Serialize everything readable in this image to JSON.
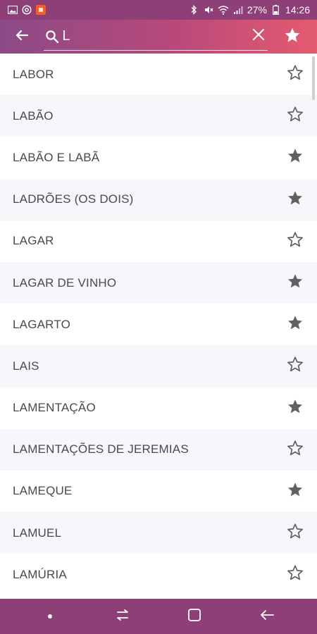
{
  "status_bar": {
    "battery": "27%",
    "time": "14:26"
  },
  "app_bar": {
    "search_value": "L",
    "colors": {
      "gradient_start": "#8b4a86",
      "gradient_end": "#e45b6f"
    }
  },
  "items": [
    {
      "label": "LABOR",
      "favorite": false
    },
    {
      "label": "LABÃO",
      "favorite": false
    },
    {
      "label": "LABÃO E LABÃ",
      "favorite": true
    },
    {
      "label": "LADRÕES (OS DOIS)",
      "favorite": true
    },
    {
      "label": "LAGAR",
      "favorite": false
    },
    {
      "label": "LAGAR DE VINHO",
      "favorite": true
    },
    {
      "label": "LAGARTO",
      "favorite": true
    },
    {
      "label": "LAIS",
      "favorite": false
    },
    {
      "label": "LAMENTAÇÃO",
      "favorite": true
    },
    {
      "label": "LAMENTAÇÕES DE JEREMIAS",
      "favorite": false
    },
    {
      "label": "LAMEQUE",
      "favorite": true
    },
    {
      "label": "LAMUEL",
      "favorite": false
    },
    {
      "label": "LAMÚRIA",
      "favorite": false
    }
  ],
  "icons": {
    "back": "arrow-left-icon",
    "search": "search-icon",
    "clear": "close-icon",
    "favorites": "star-icon",
    "star_outline": "star-outline-icon",
    "star_filled": "star-filled-icon"
  }
}
